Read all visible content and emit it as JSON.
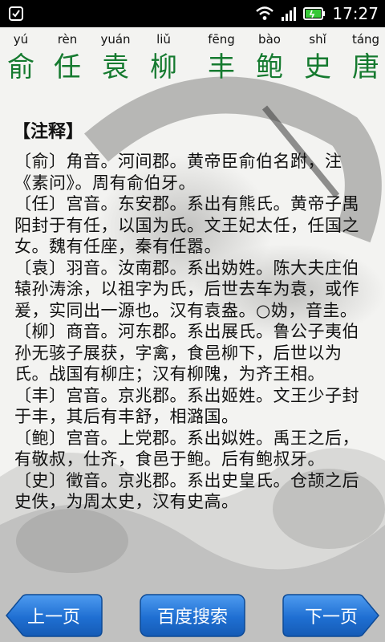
{
  "status_bar": {
    "time": "17:27"
  },
  "title": {
    "pinyin": [
      "yú",
      "rèn",
      "yuán",
      "liǔ",
      "fēng",
      "bào",
      "shǐ",
      "táng"
    ],
    "hanzi": [
      "俞",
      "任",
      "袁",
      "柳",
      "丰",
      "鲍",
      "史",
      "唐"
    ]
  },
  "content": {
    "heading": "【注释】",
    "entries": [
      "〔俞〕角音。河间郡。黄帝臣俞伯名跗，注《素问》。周有俞伯牙。",
      "〔任〕宫音。东安郡。系出有熊氏。黄帝子禺阳封于有任，以国为氏。文王妃太任，任国之女。魏有任座，秦有任嚣。",
      "〔袁〕羽音。汝南郡。系出妫姓。陈大夫庄伯辕孙涛涂，以祖字为氏，后世去车为袁，或作爰，实同出一源也。汉有袁盎。○妫，音圭。",
      "〔柳〕商音。河东郡。系出展氏。鲁公子夷伯孙无骇子展获，字禽，食邑柳下，后世以为氏。战国有柳庄；汉有柳隗，为齐王相。",
      "〔丰〕宫音。京兆郡。系出姬姓。文王少子封于丰，其后有丰舒，相潞国。",
      "〔鲍〕宫音。上党郡。系出姒姓。禹王之后，有敬叔，仕齐，食邑于鲍。后有鲍叔牙。",
      "〔史〕徵音。京兆郡。系出史皇氏。仓颉之后史佚，为周太史，汉有史高。"
    ]
  },
  "buttons": {
    "prev": "上一页",
    "search": "百度搜索",
    "next": "下一页"
  },
  "colors": {
    "title_green": "#157a2f",
    "button_blue": "#1f6fd2"
  }
}
